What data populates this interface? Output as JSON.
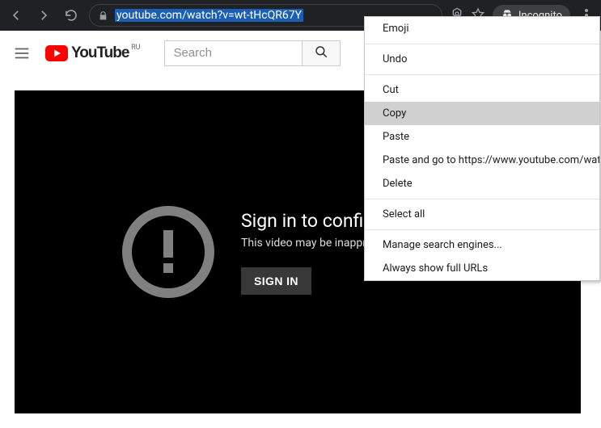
{
  "browser": {
    "url": "youtube.com/watch?v=wt-tHcQR67Y",
    "incognito_label": "Incognito"
  },
  "yt_header": {
    "logo_text": "YouTube",
    "locale": "RU",
    "search_placeholder": "Search"
  },
  "video": {
    "title": "Sign in to confirm your age",
    "subtitle": "This video may be inappropriate for some users.",
    "signin_label": "SIGN IN"
  },
  "context_menu": {
    "items": [
      {
        "label": "Emoji",
        "sep_after": true
      },
      {
        "label": "Undo",
        "sep_after": true
      },
      {
        "label": "Cut"
      },
      {
        "label": "Copy",
        "highlight": true
      },
      {
        "label": "Paste"
      },
      {
        "label": "Paste and go to https://www.youtube.com/watch?v"
      },
      {
        "label": "Delete",
        "sep_after": true
      },
      {
        "label": "Select all",
        "sep_after": true
      },
      {
        "label": "Manage search engines..."
      },
      {
        "label": "Always show full URLs"
      }
    ]
  }
}
